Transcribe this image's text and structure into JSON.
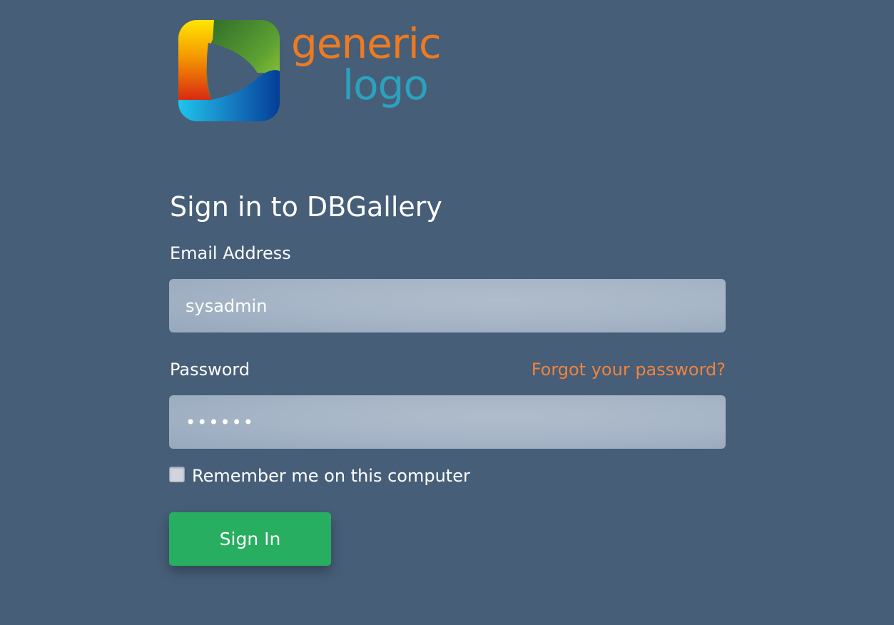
{
  "logo": {
    "line1": "generic",
    "line2": "logo",
    "colors": {
      "line1": "#ee7b1f",
      "line2": "#2ca1bd"
    }
  },
  "form": {
    "title": "Sign in to DBGallery",
    "email": {
      "label": "Email Address",
      "value": "sysadmin"
    },
    "password": {
      "label": "Password",
      "masked_value": "••••••",
      "forgot_link": "Forgot your password?"
    },
    "remember": {
      "label": "Remember me on this computer",
      "checked": false
    },
    "submit_label": "Sign In"
  },
  "colors": {
    "background": "#465e78",
    "field_background": "#a7b6c7",
    "accent_link": "#f0833f",
    "button": "#27ae60"
  }
}
